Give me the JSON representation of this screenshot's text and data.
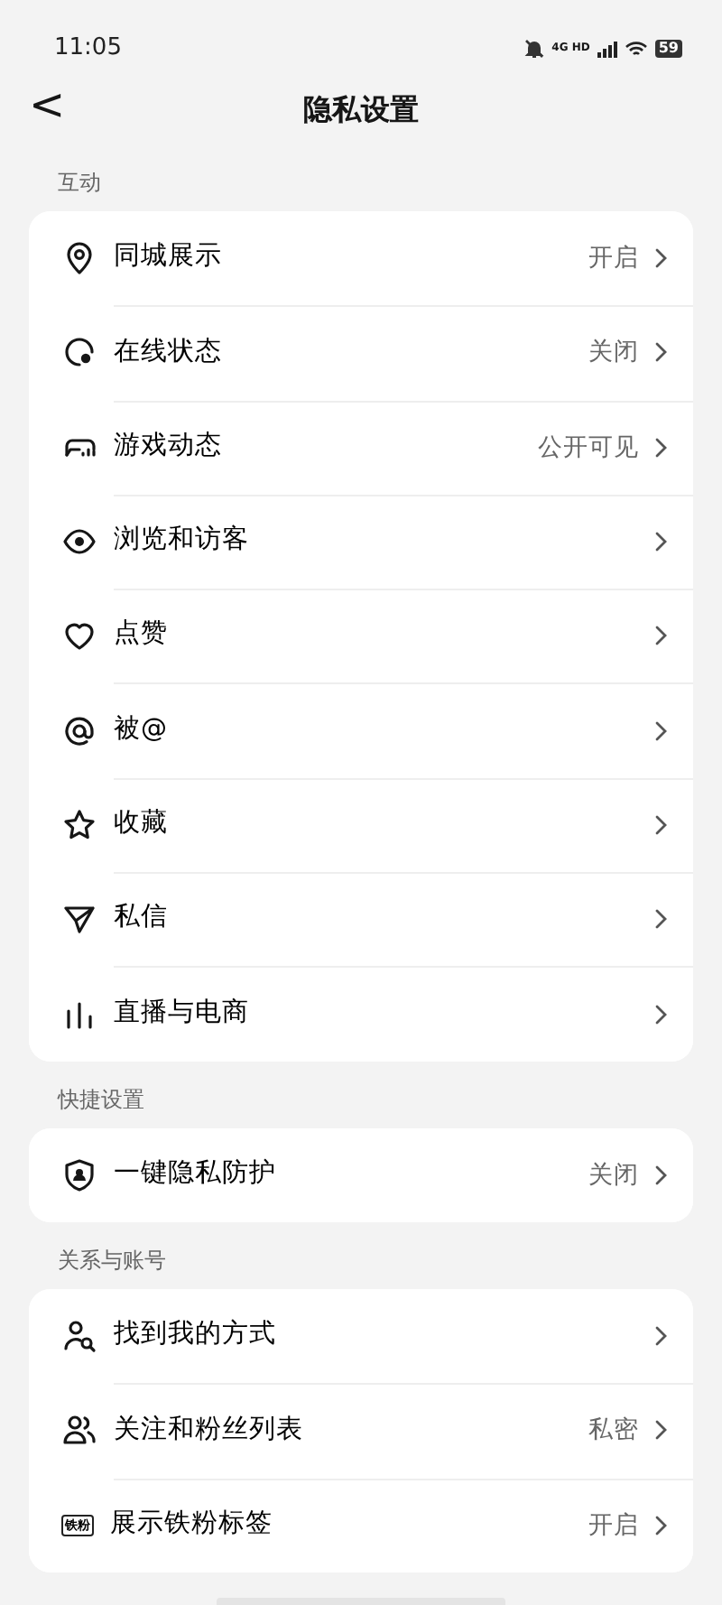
{
  "status_bar": {
    "time": "11:05",
    "network": "4G HD",
    "battery": "59"
  },
  "header": {
    "back": "<",
    "title": "隐私设置"
  },
  "sections": [
    {
      "title": "互动",
      "items": [
        {
          "label": "同城展示",
          "value": "开启"
        },
        {
          "label": "在线状态",
          "value": "关闭"
        },
        {
          "label": "游戏动态",
          "value": "公开可见"
        },
        {
          "label": "浏览和访客"
        },
        {
          "label": "点赞"
        },
        {
          "label": "被@"
        },
        {
          "label": "收藏"
        },
        {
          "label": "私信"
        },
        {
          "label": "直播与电商"
        }
      ]
    },
    {
      "title": "快捷设置",
      "items": [
        {
          "label": "一键隐私防护",
          "value": "关闭"
        }
      ]
    },
    {
      "title": "关系与账号",
      "items": [
        {
          "label": "找到我的方式"
        },
        {
          "label": "关注和粉丝列表",
          "value": "私密"
        },
        {
          "label": "展示铁粉标签",
          "value": "开启",
          "badge": "铁粉"
        }
      ]
    }
  ]
}
